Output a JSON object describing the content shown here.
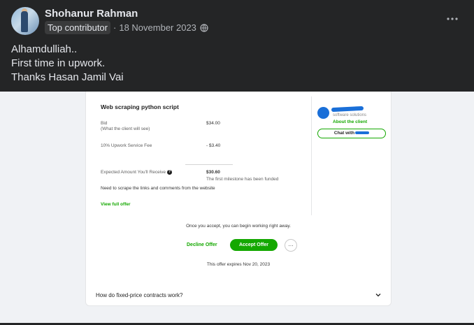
{
  "post": {
    "author": "Shohanur Rahman",
    "badge": "Top contributor",
    "date": "18 November 2023",
    "lines": [
      "Alhamdulliah..",
      "First time in upwork.",
      "Thanks Hasan Jamil Vai"
    ]
  },
  "offer": {
    "job_title": "Web scraping python script",
    "bid_label": "Bid",
    "bid_sub": "(What the client will see)",
    "bid_value": "$34.00",
    "fee_label": "10% Upwork Service Fee",
    "fee_value": "- $3.40",
    "expected_label": "Expected Amount You'll Receive",
    "expected_value": "$30.60",
    "milestone_note": "The first milestone has been funded",
    "description": "Need to scrape the links and comments from the website",
    "view_full": "View full offer",
    "client_sub": "software solutions",
    "about_client": "About the client",
    "chat_label": "Chat with",
    "start_note": "Once you accept, you can begin working right away.",
    "decline": "Decline Offer",
    "accept": "Accept Offer",
    "more": "…",
    "expires": "This offer expires Nov 20, 2023",
    "faq": "How do fixed-price contracts work?"
  },
  "colors": {
    "upwork_green": "#14a800",
    "fb_dark": "#242526",
    "scribble_blue": "#1a6fd8"
  },
  "icons": [
    "globe-icon",
    "more-options-icon",
    "question-icon",
    "chevron-down-icon"
  ]
}
